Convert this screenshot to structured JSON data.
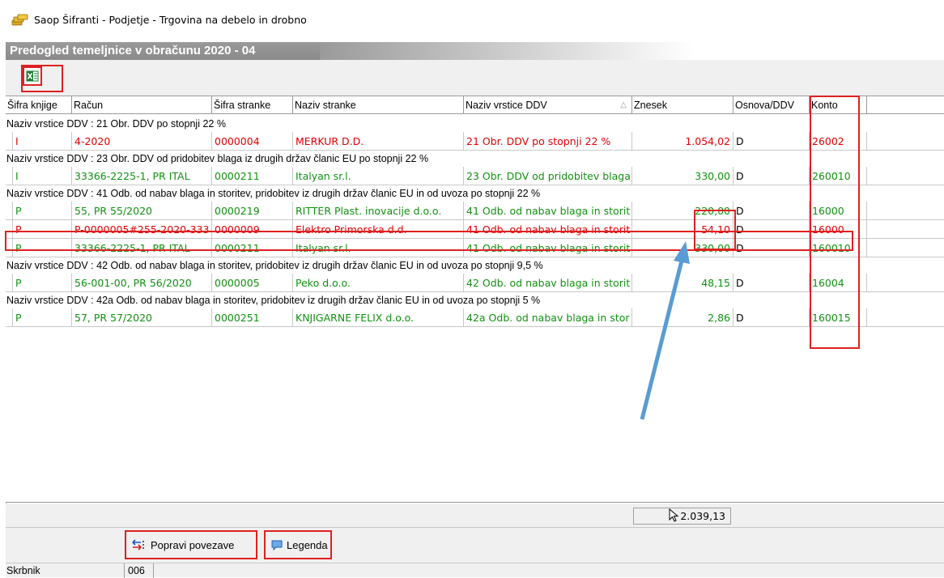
{
  "window": {
    "title": "Saop Šifranti - Podjetje - Trgovina na debelo in drobno",
    "caption": "Predogled temeljnice v obračunu  2020 - 04"
  },
  "toolbar": {
    "export_icon": "excel-export-icon"
  },
  "columns": [
    "Šifra knjige",
    "Račun",
    "Šifra stranke",
    "Naziv stranke",
    "Naziv vrstice DDV",
    "Znesek",
    "Osnova/DDV",
    "Konto"
  ],
  "groups": [
    {
      "label": "Naziv vrstice DDV : 21 Obr. DDV po stopnji 22 %",
      "rows": [
        {
          "color": "red",
          "cells": [
            "I",
            "4-2020",
            "0000004",
            "MERKUR D.D.",
            "21 Obr. DDV po stopnji 22 %",
            "1.054,02",
            "D",
            "26002"
          ]
        }
      ]
    },
    {
      "label": "Naziv vrstice DDV : 23 Obr. DDV od pridobitev blaga iz drugih držav članic EU po stopnji 22 %",
      "rows": [
        {
          "color": "green",
          "cells": [
            "I",
            "33366-2225-1, PR ITAL",
            "0000211",
            "Italyan sr.l.",
            "23 Obr. DDV od pridobitev blaga",
            "330,00",
            "D",
            "260010"
          ]
        }
      ]
    },
    {
      "label": "Naziv vrstice DDV : 41 Odb. od nabav blaga in storitev, pridobitev iz drugih držav članic EU in od uvoza po stopnji 22 %",
      "rows": [
        {
          "color": "green",
          "cells": [
            "P",
            "55, PR 55/2020",
            "0000219",
            "RITTER Plast. inovacije d.o.o.",
            "41 Odb. od nabav blaga in storit",
            "220,00",
            "D",
            "16000"
          ]
        },
        {
          "color": "red",
          "cells": [
            "P",
            "P-0000005#255-2020-333",
            "0000009",
            "Elektro Primorska d.d.",
            "41 Odb. od nabav blaga in storit",
            "54,10",
            "D",
            "16000"
          ]
        },
        {
          "color": "green",
          "cells": [
            "P",
            "33366-2225-1, PR ITAL",
            "0000211",
            "Italyan sr.l.",
            "41 Odb. od nabav blaga in storit",
            "330,00",
            "D",
            "160010"
          ]
        }
      ]
    },
    {
      "label": "Naziv vrstice DDV : 42 Odb. od nabav blaga in storitev, pridobitev iz drugih držav članic EU in od uvoza po stopnji 9,5 %",
      "rows": [
        {
          "color": "green",
          "cells": [
            "P",
            "56-001-00, PR 56/2020",
            "0000005",
            "Peko d.o.o.",
            "42 Odb. od nabav blaga in storit",
            "48,15",
            "D",
            "16004"
          ]
        }
      ]
    },
    {
      "label": "Naziv vrstice DDV : 42a Odb. od nabav blaga in storitev, pridobitev iz drugih držav članic EU in od uvoza po stopnji 5 %",
      "rows": [
        {
          "color": "green",
          "cells": [
            "P",
            "57, PR 57/2020",
            "0000251",
            "KNJIGARNE FELIX d.o.o.",
            "42a Odb. od nabav blaga in stor",
            "2,86",
            "D",
            "160015"
          ]
        }
      ]
    }
  ],
  "total": "2.039,13",
  "buttons": {
    "fix_links": "Popravi povezave",
    "legend": "Legenda"
  },
  "status": {
    "label": "Skrbnik",
    "value": "006"
  },
  "colors": {
    "highlight": "#e02020",
    "arrow": "#5b9bd5",
    "green_row": "#119111",
    "red_row": "#e00000"
  }
}
